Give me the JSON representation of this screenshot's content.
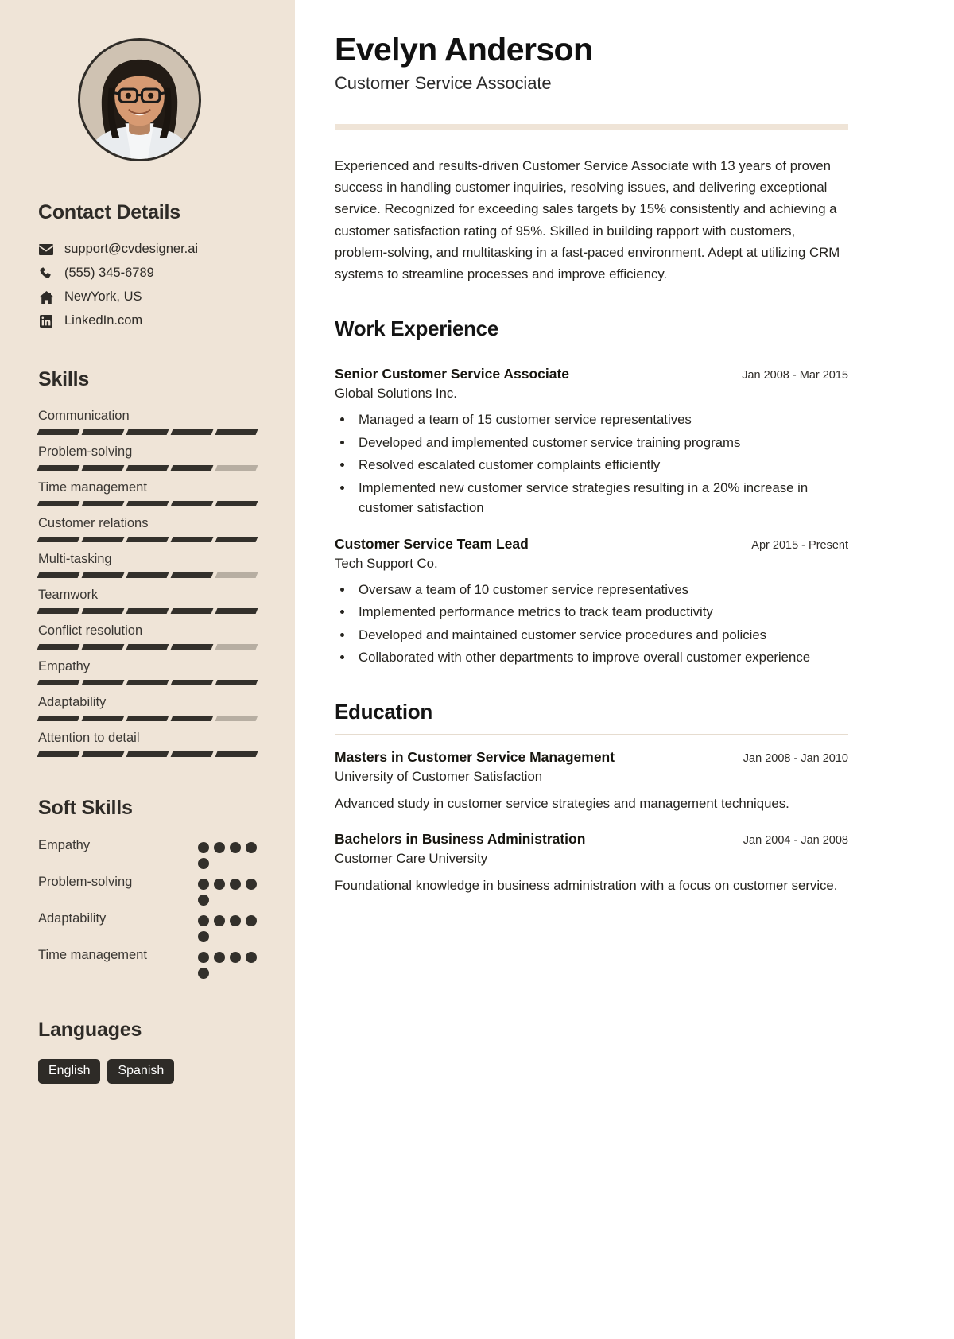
{
  "sidebar": {
    "avatar_alt": "profile-photo",
    "contact": {
      "heading": "Contact Details",
      "items": [
        {
          "icon": "envelope-icon",
          "value": "support@cvdesigner.ai"
        },
        {
          "icon": "phone-icon",
          "value": "(555) 345-6789"
        },
        {
          "icon": "home-icon",
          "value": "NewYork, US"
        },
        {
          "icon": "linkedin-icon",
          "value": "LinkedIn.com"
        }
      ]
    },
    "skills": {
      "heading": "Skills",
      "max": 5,
      "items": [
        {
          "name": "Communication",
          "level": 5
        },
        {
          "name": "Problem-solving",
          "level": 4
        },
        {
          "name": "Time management",
          "level": 5
        },
        {
          "name": "Customer relations",
          "level": 5
        },
        {
          "name": "Multi-tasking",
          "level": 4
        },
        {
          "name": "Teamwork",
          "level": 5
        },
        {
          "name": "Conflict resolution",
          "level": 4
        },
        {
          "name": "Empathy",
          "level": 5
        },
        {
          "name": "Adaptability",
          "level": 4
        },
        {
          "name": "Attention to detail",
          "level": 5
        }
      ]
    },
    "soft_skills": {
      "heading": "Soft Skills",
      "max": 5,
      "items": [
        {
          "name": "Empathy",
          "level": 5
        },
        {
          "name": "Problem-solving",
          "level": 5
        },
        {
          "name": "Adaptability",
          "level": 5
        },
        {
          "name": "Time management",
          "level": 5
        }
      ]
    },
    "languages": {
      "heading": "Languages",
      "items": [
        "English",
        "Spanish"
      ]
    }
  },
  "main": {
    "name": "Evelyn Anderson",
    "role": "Customer Service Associate",
    "summary": "Experienced and results-driven Customer Service Associate with 13 years of proven success in handling customer inquiries, resolving issues, and delivering exceptional service. Recognized for exceeding sales targets by 15% consistently and achieving a customer satisfaction rating of 95%. Skilled in building rapport with customers, problem-solving, and multitasking in a fast-paced environment. Adept at utilizing CRM systems to streamline processes and improve efficiency.",
    "work": {
      "heading": "Work Experience",
      "entries": [
        {
          "title": "Senior Customer Service Associate",
          "date": "Jan 2008 - Mar 2015",
          "company": "Global Solutions Inc.",
          "bullets": [
            "Managed a team of 15 customer service representatives",
            "Developed and implemented customer service training programs",
            "Resolved escalated customer complaints efficiently",
            "Implemented new customer service strategies resulting in a 20% increase in customer satisfaction"
          ]
        },
        {
          "title": "Customer Service Team Lead",
          "date": "Apr 2015 - Present",
          "company": "Tech Support Co.",
          "bullets": [
            "Oversaw a team of 10 customer service representatives",
            "Implemented performance metrics to track team productivity",
            "Developed and maintained customer service procedures and policies",
            "Collaborated with other departments to improve overall customer experience"
          ]
        }
      ]
    },
    "education": {
      "heading": "Education",
      "entries": [
        {
          "title": "Masters in Customer Service Management",
          "date": "Jan 2008 - Jan 2010",
          "school": "University of Customer Satisfaction",
          "description": "Advanced study in customer service strategies and management techniques."
        },
        {
          "title": "Bachelors in Business Administration",
          "date": "Jan 2004 - Jan 2008",
          "school": "Customer Care University",
          "description": "Foundational knowledge in business administration with a focus on customer service."
        }
      ]
    }
  },
  "colors": {
    "sidebar_bg": "#EFE4D7",
    "ink": "#2e2b27",
    "bar_on": "#33302b",
    "bar_off": "#b7aea2",
    "tag_bg": "#2e2b27"
  }
}
